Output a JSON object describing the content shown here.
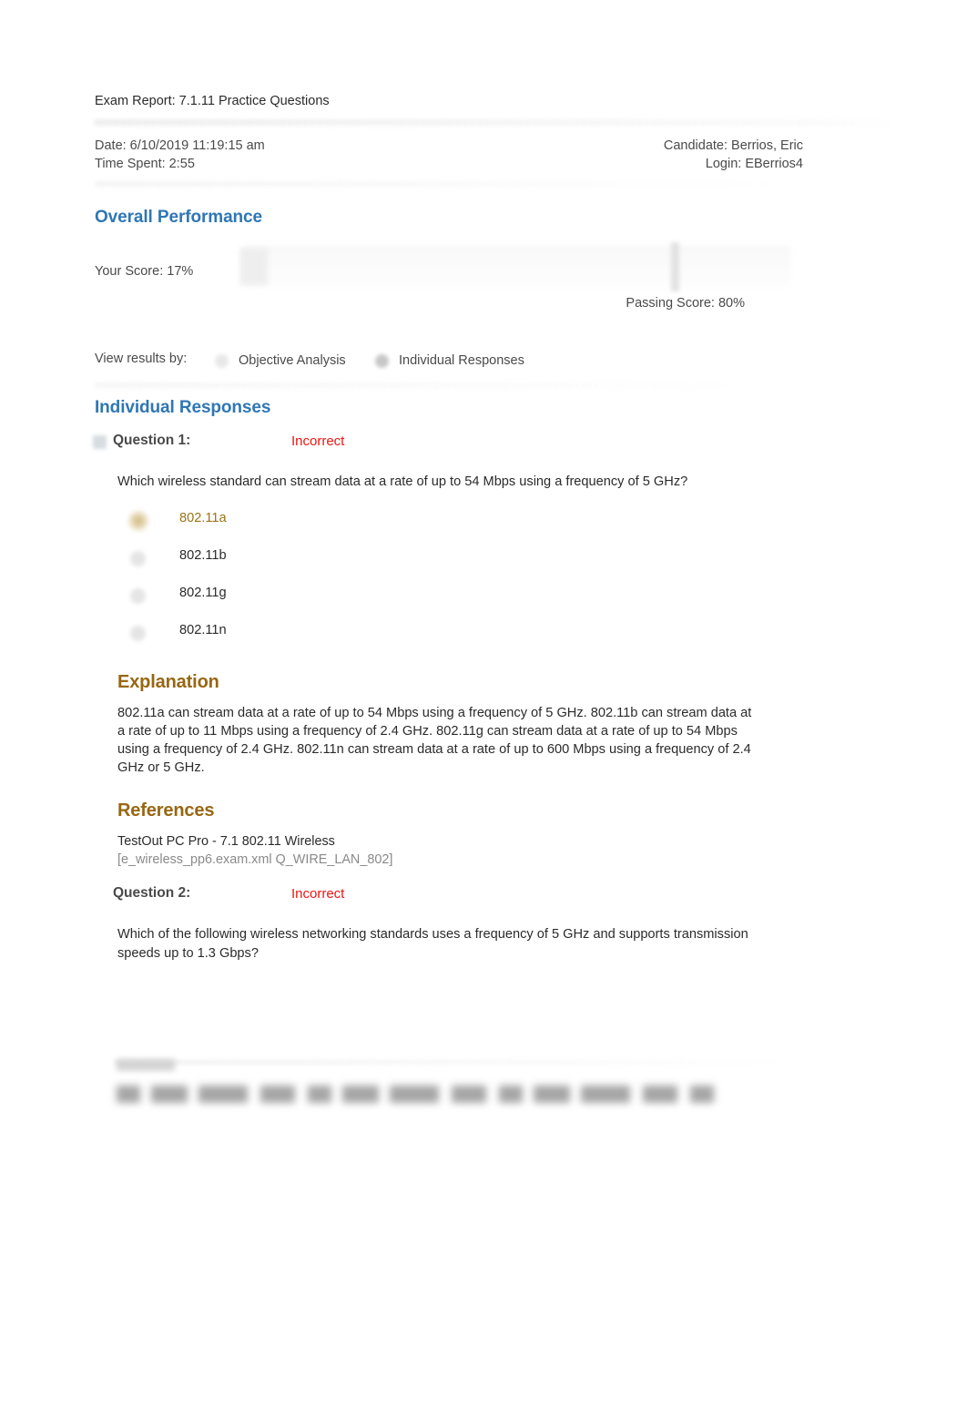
{
  "report": {
    "title": "Exam Report: 7.1.11 Practice Questions",
    "date_label": "Date: 6/10/2019 11:19:15 am",
    "time_spent_label": "Time Spent: 2:55",
    "candidate_label": "Candidate: Berrios, Eric",
    "login_label": "Login: EBerrios4"
  },
  "overall_performance": {
    "heading": "Overall Performance",
    "your_score_label": "Your Score: 17%",
    "your_score_percent": 17,
    "passing_score_label": "Passing Score: 80%",
    "passing_score_percent": 80
  },
  "view_results": {
    "label": "View results by:",
    "options": [
      {
        "label": "Objective Analysis",
        "selected": false
      },
      {
        "label": "Individual Responses",
        "selected": true
      }
    ]
  },
  "individual_responses": {
    "heading": "Individual Responses",
    "questions": [
      {
        "label": "Question 1:",
        "status": "Incorrect",
        "prompt": "Which wireless standard can stream data at a rate of up to 54 Mbps using a frequency of 5 GHz?",
        "options": [
          {
            "text": "802.11a",
            "correct": true
          },
          {
            "text": "802.11b",
            "correct": false
          },
          {
            "text": "802.11g",
            "correct": false
          },
          {
            "text": "802.11n",
            "correct": false
          }
        ],
        "explanation_heading": "Explanation",
        "explanation": "802.11a can stream data at a rate of up to 54 Mbps using a frequency of 5 GHz. 802.11b can stream data at a rate of up to 11 Mbps using a frequency of 2.4 GHz. 802.11g can stream data at a rate of up to 54 Mbps using a frequency of 2.4 GHz. 802.11n can stream data at a rate of up to 600 Mbps using a frequency of 2.4 GHz or 5 GHz.",
        "references_heading": "References",
        "reference_title": "TestOut PC Pro - 7.1 802.11 Wireless",
        "reference_id": "[e_wireless_pp6.exam.xml Q_WIRE_LAN_802]"
      },
      {
        "label": "Question 2:",
        "status": "Incorrect",
        "prompt": "Which of the following wireless networking standards uses a frequency of 5 GHz and supports transmission speeds up to 1.3 Gbps?"
      }
    ]
  },
  "colors": {
    "section_heading": "#2f76b4",
    "sub_heading": "#976713",
    "incorrect": "#ee1510",
    "correct_option": "#9a7418",
    "body_text": "#2b2b2b",
    "muted_text": "#8a8a8a"
  }
}
